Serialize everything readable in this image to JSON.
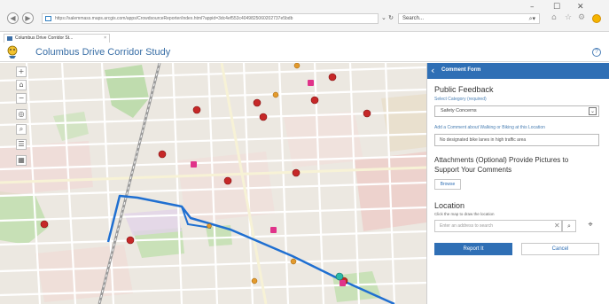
{
  "browser": {
    "url": "https://salemmass.maps.arcgis.com/apps/CrowdsourceReporter/index.html?appid=3dc4ef553c4049825060202737e5bdb",
    "search_placeholder": "Search...",
    "tab_title": "Columbus Drive Corridor St...",
    "tab_close": "×",
    "minimize": "–",
    "maximize": "☐",
    "close": "✕"
  },
  "app": {
    "title": "Columbus Drive Corridor Study",
    "help": "?"
  },
  "map_tools": [
    "+",
    "⌂",
    "−",
    "◎",
    "⌕",
    "☰",
    "▦"
  ],
  "panel": {
    "header_title": "Comment Form",
    "form_title": "Public Feedback",
    "category_label": "Select Category (required)",
    "category_value": "Safety Concerns",
    "comment_label": "Add a Comment about Walking or Biking at this Location",
    "comment_value": "No designated bike lanes in high traffic area",
    "attachments_title": "Attachments (Optional) Provide Pictures to Support Your Comments",
    "browse_label": "Browse",
    "location_title": "Location",
    "location_hint": "Click the map to draw the location",
    "address_placeholder": "Enter an address to search",
    "report_label": "Report It",
    "cancel_label": "Cancel"
  },
  "colors": {
    "accent": "#2f6fb5",
    "route": "#1f6fd1",
    "map_bg": "#ece8e1",
    "park": "#bfdcae",
    "marker": "#c62828",
    "bike_marker": "#e0338a",
    "orange_marker": "#e39a2d"
  }
}
